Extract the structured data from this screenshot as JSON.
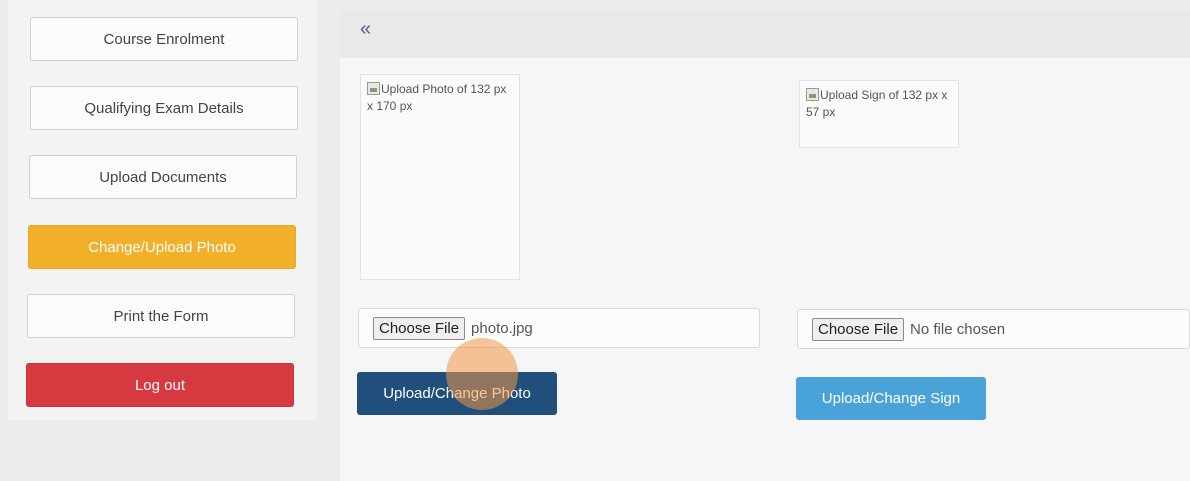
{
  "sidebar": {
    "items": [
      {
        "label": "Course Enrolment"
      },
      {
        "label": "Qualifying Exam Details"
      },
      {
        "label": "Upload Documents"
      },
      {
        "label": "Change/Upload Photo"
      },
      {
        "label": "Print the Form"
      },
      {
        "label": "Log out"
      }
    ]
  },
  "main": {
    "collapse_icon": "«",
    "photo": {
      "alt": "Upload Photo of 132 px x 170 px",
      "choose_label": "Choose File",
      "file_name": "photo.jpg",
      "button_label": "Upload/Change Photo"
    },
    "sign": {
      "alt": "Upload Sign of 132 px x 57 px",
      "choose_label": "Choose File",
      "file_name": "No file chosen",
      "button_label": "Upload/Change Sign"
    }
  },
  "colors": {
    "active": "#f2b02a",
    "danger": "#d6393f",
    "primary_dark": "#1f4f7a",
    "primary_light": "#4aa3d8"
  }
}
